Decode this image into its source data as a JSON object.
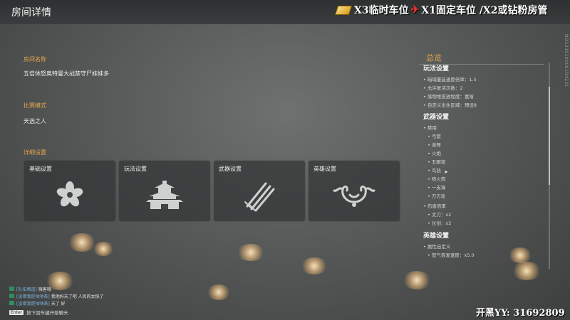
{
  "header": {
    "title": "房间详情",
    "banner_left": "X3临时车位",
    "banner_right": "X1固定车位 /X2或钻粉房管",
    "side_id": "NO233010000104231"
  },
  "room": {
    "name_label": "房间名称",
    "name_value": "五倍体怒奥特曼大战禁守尸妹妹多",
    "mode_label": "比赛模式",
    "mode_value": "天选之人",
    "detail_label": "详细设置"
  },
  "cards": [
    {
      "label": "基础设置",
      "icon": "flower-crest-icon"
    },
    {
      "label": "玩法设置",
      "icon": "pagoda-icon"
    },
    {
      "label": "武器设置",
      "icon": "swords-icon"
    },
    {
      "label": "英雄设置",
      "icon": "ornament-mask-icon"
    }
  ],
  "overview": {
    "title": "总览",
    "play_head": "玩法设置",
    "play_items": [
      "暗域蔓延速度倍率：1.5",
      "允许复活次数：2",
      "落物堆投放程度：富裕",
      "自定义出生区域：预设8"
    ],
    "weapon_head": "武器设置",
    "disabled_label": "禁用",
    "weapon_items": [
      "弓箭",
      "连弩",
      "火炮",
      "五眼铳",
      "鸟铳",
      "喷火筒",
      "一支锋",
      "万刃轮"
    ],
    "damage_label": "伤害倍率",
    "damage_items": [
      "太刀：x2",
      "长剑：x2"
    ],
    "hero_head": "英雄设置",
    "hero_sub": "属性自定义",
    "hero_items": [
      "怒气恢复速度：x5.0"
    ]
  },
  "chat": {
    "lines": [
      {
        "channel": "[队伍频道]",
        "text": "嗨害嗨"
      },
      {
        "channel": "[没错我是咕咕茶]",
        "text": "我他妈天了吧 人民的太快了"
      },
      {
        "channel": "[没错我是咕咕茶]",
        "text": "天了 好"
      }
    ],
    "enter_key": "Enter",
    "enter_hint": "按下回车键开始聊天"
  },
  "yy": "开黑YY: 31692809"
}
